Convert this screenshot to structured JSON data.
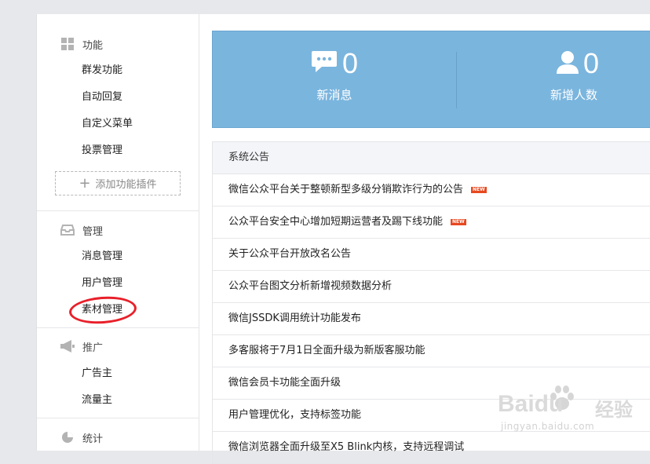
{
  "sidebar": {
    "function": {
      "title": "功能",
      "items": [
        "群发功能",
        "自动回复",
        "自定义菜单",
        "投票管理"
      ],
      "add_plugin": "添加功能插件"
    },
    "manage": {
      "title": "管理",
      "items": [
        "消息管理",
        "用户管理",
        "素材管理"
      ]
    },
    "promote": {
      "title": "推广",
      "items": [
        "广告主",
        "流量主"
      ]
    },
    "stats": {
      "title": "统计"
    }
  },
  "stats_panel": {
    "new_messages": {
      "value": "0",
      "label": "新消息",
      "icon": "message-bubble-icon"
    },
    "new_users": {
      "value": "0",
      "label": "新增人数",
      "icon": "user-icon"
    }
  },
  "announcements": {
    "title": "系统公告",
    "new_badge": "NEW",
    "items": [
      "微信公众平台关于整顿新型多级分销欺诈行为的公告",
      "公众平台安全中心增加短期运营者及踢下线功能",
      "关于公众平台开放改名公告",
      "公众平台图文分析新增视频数据分析",
      "微信JSSDK调用统计功能发布",
      "多客服将于7月1日全面升级为新版客服功能",
      "微信会员卡功能全面升级",
      "用户管理优化，支持标签功能",
      "微信浏览器全面升级至X5 Blink内核，支持远程调试"
    ]
  },
  "watermark": {
    "brand": "Baidu",
    "brand_cn": "经验",
    "url": "jingyan.baidu.com"
  },
  "colors": {
    "stats_bg": "#7ab5de",
    "highlight_circle": "#e8202a",
    "new_badge": "#e8481f"
  }
}
